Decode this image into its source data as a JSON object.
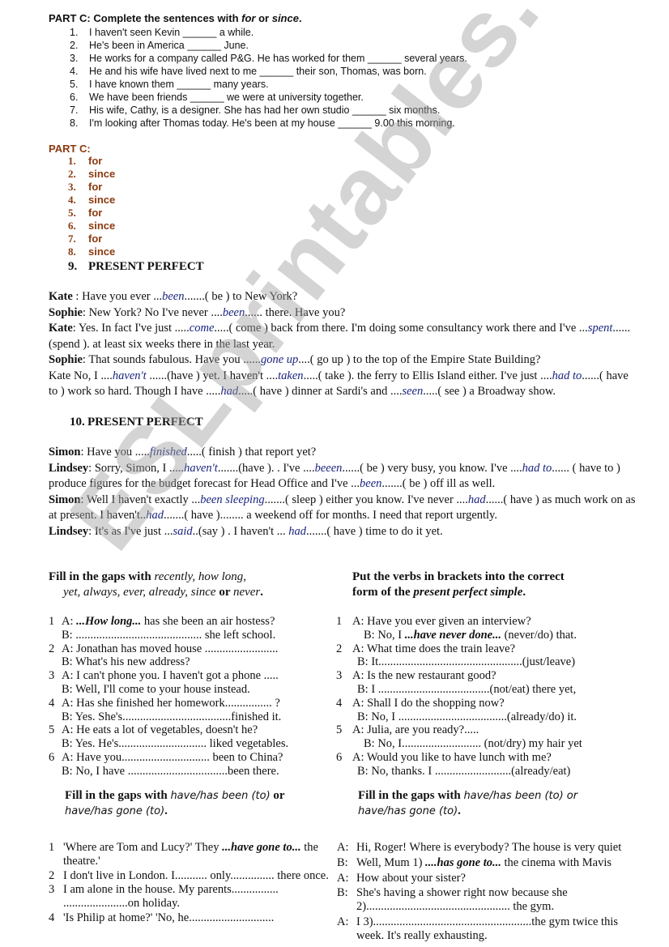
{
  "watermark": "ESLprintables.com",
  "part_c": {
    "title_prefix": "PART C: Complete the sentences with ",
    "title_for": "for",
    "title_or": " or ",
    "title_since": "since",
    "title_end": ".",
    "items": [
      {
        "num": "1.",
        "text": "I haven't seen Kevin ______ a while."
      },
      {
        "num": "2.",
        "text": "He's been in America ______ June."
      },
      {
        "num": "3.",
        "text": "He works for a company called P&G. He has worked for them ______ several years."
      },
      {
        "num": "4.",
        "text": "He and his wife have lived next to me ______ their son, Thomas, was born."
      },
      {
        "num": "5.",
        "text": "I have known them ______ many years."
      },
      {
        "num": "6.",
        "text": "We have been friends ______ we were at university together."
      },
      {
        "num": "7.",
        "text": "His wife, Cathy, is a designer. She has had her own studio ______ six months."
      },
      {
        "num": "8.",
        "text": "I'm looking after Thomas today. He's been at my house ______ 9.00 this morning."
      }
    ]
  },
  "answers": {
    "title": "PART C:",
    "color": "#8b3a0f",
    "items": [
      {
        "num": "1.",
        "value": "for"
      },
      {
        "num": "2.",
        "value": "since"
      },
      {
        "num": "3.",
        "value": "for"
      },
      {
        "num": "4.",
        "value": "since"
      },
      {
        "num": "5.",
        "value": "for"
      },
      {
        "num": "6.",
        "value": "since"
      },
      {
        "num": "7.",
        "value": "for"
      },
      {
        "num": "8.",
        "value": "since"
      }
    ]
  },
  "section9": {
    "num": "9.",
    "title": "PRESENT PERFECT",
    "lines": [
      [
        {
          "t": "Kate",
          "s": "spk"
        },
        {
          "t": " : Have you ever ..."
        },
        {
          "t": "been",
          "s": "fill"
        },
        {
          "t": ".......( be ) to New York?"
        }
      ],
      [
        {
          "t": "Sophie",
          "s": "spk"
        },
        {
          "t": ": New York? No I've never ...."
        },
        {
          "t": "been",
          "s": "fill"
        },
        {
          "t": "...... there. Have you?"
        }
      ],
      [
        {
          "t": "Kate",
          "s": "spk"
        },
        {
          "t": ": Yes. In fact I've just ....."
        },
        {
          "t": "come",
          "s": "fill"
        },
        {
          "t": ".....( come ) back from there. I'm doing some consultancy work there and I've ..."
        },
        {
          "t": "spent",
          "s": "fill"
        },
        {
          "t": "......(spend ). at least six weeks there in the last year."
        }
      ],
      [
        {
          "t": "Sophie",
          "s": "spk"
        },
        {
          "t": ": That sounds fabulous. Have you ......"
        },
        {
          "t": "gone up",
          "s": "fill"
        },
        {
          "t": "....( go up ) to the top of the Empire State Building?"
        }
      ],
      [
        {
          "t": "Kate No, I ...."
        },
        {
          "t": "haven't",
          "s": "fill"
        },
        {
          "t": " ......(have ) yet. I haven't ...."
        },
        {
          "t": "taken",
          "s": "fill"
        },
        {
          "t": ".....( take ). the ferry to Ellis Island either. I've just ...."
        },
        {
          "t": "had to",
          "s": "fill"
        },
        {
          "t": "......( have to ) work so hard. Though I have ....."
        },
        {
          "t": "had",
          "s": "fill"
        },
        {
          "t": ".....( have ) dinner at Sardi's and ...."
        },
        {
          "t": "seen",
          "s": "fill"
        },
        {
          "t": ".....( see )  a Broadway show."
        }
      ]
    ]
  },
  "section10": {
    "num": "10.",
    "title": "PRESENT PERFECT",
    "lines": [
      [
        {
          "t": "Simon",
          "s": "spk"
        },
        {
          "t": ": Have you ....."
        },
        {
          "t": "finished",
          "s": "fill"
        },
        {
          "t": ".....( finish ) that report yet?"
        }
      ],
      [
        {
          "t": "Lindsey",
          "s": "spk"
        },
        {
          "t": ": Sorry, Simon, I ....."
        },
        {
          "t": "haven't",
          "s": "fill"
        },
        {
          "t": ".......(have ). . I've ...."
        },
        {
          "t": "beeen",
          "s": "fill"
        },
        {
          "t": "......( be ) very busy, you know. I've ...."
        },
        {
          "t": "had to",
          "s": "fill"
        },
        {
          "t": "...... ( have to ) produce figures for the budget forecast for Head Office and I've ..."
        },
        {
          "t": "been",
          "s": "fill"
        },
        {
          "t": ".......( be ) off ill as well."
        }
      ],
      [
        {
          "t": "Simon",
          "s": "spk"
        },
        {
          "t": ": Well I haven't exactly ..."
        },
        {
          "t": "been sleeping",
          "s": "fill"
        },
        {
          "t": ".......( sleep ) either you know. I've never ...."
        },
        {
          "t": "had",
          "s": "fill"
        },
        {
          "t": "......( have ) as much work on as at present. I haven't.."
        },
        {
          "t": "had",
          "s": "fill"
        },
        {
          "t": ".......( have )........ a weekend off for months. I need that report urgently."
        }
      ],
      [
        {
          "t": "Lindsey",
          "s": "spk"
        },
        {
          "t": ": It's as I've just ..."
        },
        {
          "t": "said",
          "s": "fill"
        },
        {
          "t": "..(say ) . I haven't ... "
        },
        {
          "t": "had",
          "s": "fill"
        },
        {
          "t": ".......( have ) time to do it yet."
        }
      ]
    ]
  },
  "exercise_adverbs": {
    "title_bold": "Fill in the gaps with ",
    "title_it1": "recently, how long,",
    "title_it2": "yet, always, ever, already, since",
    "title_or": " or ",
    "title_it3": "never",
    "title_end": ".",
    "items": [
      {
        "num": "1",
        "a_pre": "A: ",
        "a_fill": "...How long...",
        "a_post": " has she been an air hostess?",
        "b": "B:  ........................................... she left school."
      },
      {
        "num": "2",
        "a_pre": "A: Jonathan has moved house .........................",
        "a_fill": "",
        "a_post": "",
        "b": "B: What's his new address?"
      },
      {
        "num": "3",
        "a_pre": "A: I can't phone you. I haven't got a phone .....",
        "a_fill": "",
        "a_post": "",
        "b": "B: Well, I'll come to your house instead."
      },
      {
        "num": "4",
        "a_pre": "A: Has she finished her homework................ ?",
        "a_fill": "",
        "a_post": "",
        "b": "B: Yes. She's.....................................finished it."
      },
      {
        "num": "5",
        "a_pre": "A: He eats a lot of vegetables, doesn't he?",
        "a_fill": "",
        "a_post": "",
        "b": "B: Yes. He's.............................. liked vegetables."
      },
      {
        "num": "6",
        "a_pre": "A: Have you.............................. been to China?",
        "a_fill": "",
        "a_post": "",
        "b": "B: No, I have ..................................been there."
      }
    ]
  },
  "exercise_verbs": {
    "title_line1": "Put the verbs in brackets into the correct",
    "title_line2_pre": "form of the ",
    "title_line2_bi": "present perfect simple",
    "title_end": ".",
    "items": [
      {
        "num": "1",
        "a": "A: Have you ever given an interview?",
        "b_pre": "B: No, I ",
        "b_fill": "...have never done...",
        "b_post": " (never/do) that."
      },
      {
        "num": "2",
        "a": "A: What time does the train leave?",
        "b_pre": "B: It.................................................(just/leave)",
        "b_fill": "",
        "b_post": ""
      },
      {
        "num": "3",
        "a": "A: Is the new restaurant good?",
        "b_pre": "B: I ......................................(not/eat) there yet,",
        "b_fill": "",
        "b_post": ""
      },
      {
        "num": "4",
        "a": "A: Shall I do the shopping now?",
        "b_pre": "B: No, I .....................................(already/do) it.",
        "b_fill": "",
        "b_post": ""
      },
      {
        "num": "5",
        "a": "A: Julia, are you ready?.....",
        "b_pre": "B: No, I........................... (not/dry) my hair yet",
        "b_fill": "",
        "b_post": ""
      },
      {
        "num": "6",
        "a": "A: Would you like to have lunch with me?",
        "b_pre": "B: No, thanks. I ..........................(already/eat)",
        "b_fill": "",
        "b_post": ""
      }
    ]
  },
  "exercise_been_gone_left": {
    "title_bold": "Fill in the gaps with ",
    "title_it1": "have/has been (to)",
    "title_or": " or",
    "title_it2": "have/has gone (to)",
    "title_end": ".",
    "items": [
      {
        "num": "1",
        "pre": "'Where are Tom and Lucy?' They ",
        "fill": "...have gone to...",
        "post": " the theatre.'"
      },
      {
        "num": "2",
        "pre": "I don't live in London. I........... only............... there once.",
        "fill": "",
        "post": ""
      },
      {
        "num": "3",
        "pre": "I am alone in the house. My parents................ ......................on holiday.",
        "fill": "",
        "post": ""
      },
      {
        "num": "4",
        "pre": "'Is Philip at home?' 'No, he.............................",
        "fill": "",
        "post": ""
      }
    ]
  },
  "exercise_been_gone_right": {
    "title_bold": "Fill in the gaps with ",
    "title_it1": "have/has been (to) or",
    "title_it2": "have/has gone (to)",
    "title_end": ".",
    "lines": [
      {
        "spk": "A:",
        "pre": "Hi, Roger! Where is everybody? The house is very quiet",
        "fill": "",
        "post": ""
      },
      {
        "spk": "B:",
        "pre": "Well, Mum 1) ",
        "fill": "....has gone to...",
        "post": " the cinema with Mavis"
      },
      {
        "spk": "A:",
        "pre": "How about your sister?",
        "fill": "",
        "post": ""
      },
      {
        "spk": "B:",
        "pre": "She's having a shower right now because she 2)................................................. the gym.",
        "fill": "",
        "post": ""
      },
      {
        "spk": "A:",
        "pre": "I 3)......................................................the gym twice this week. It's really exhausting.",
        "fill": "",
        "post": ""
      }
    ]
  }
}
